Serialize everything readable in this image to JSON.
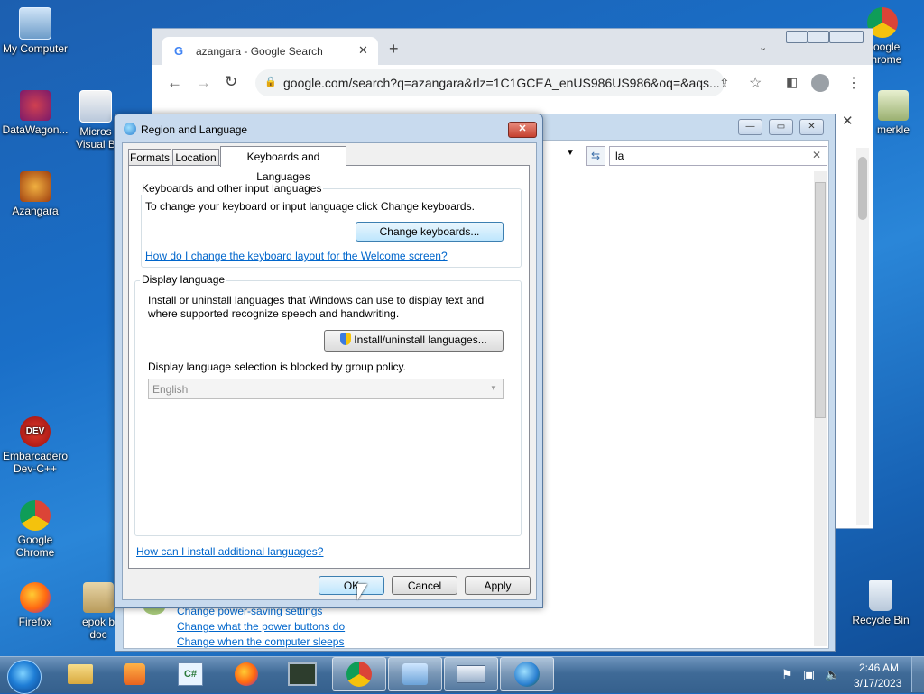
{
  "desktop": {
    "icons": [
      {
        "label": "My Computer"
      },
      {
        "label": "DataWagon..."
      },
      {
        "label": "Micros Visual B"
      },
      {
        "label": "Azangara"
      },
      {
        "label": "Embarcadero Dev-C++"
      },
      {
        "label": "Google Chrome"
      },
      {
        "label": "Firefox"
      },
      {
        "label": "epok b doc"
      },
      {
        "label": "Google Chrome"
      },
      {
        "label": "merkle"
      },
      {
        "label": "Recycle Bin"
      }
    ]
  },
  "chrome": {
    "tab_title": "azangara - Google Search",
    "url": "google.com/search?q=azangara&rlz=1C1GCEA_enUS986US986&oq=&aqs..."
  },
  "back_window": {
    "search_value": "la",
    "links": [
      "Change power-saving settings",
      "Change what the power buttons do",
      "Change when the computer sleeps"
    ]
  },
  "dialog": {
    "title": "Region and Language",
    "tabs": [
      "Formats",
      "Location",
      "Keyboards and Languages"
    ],
    "keyboards_group": {
      "title": "Keyboards and other input languages",
      "desc": "To change your keyboard or input language click Change keyboards.",
      "button": "Change keyboards...",
      "link": "How do I change the keyboard layout for the Welcome screen?"
    },
    "display_group": {
      "title": "Display language",
      "desc_line1": "Install or uninstall languages that Windows can use to display text and",
      "desc_line2": "where supported recognize speech and handwriting.",
      "button": "Install/uninstall languages...",
      "blocked": "Display language selection is blocked by group policy.",
      "selected": "English"
    },
    "bottom_link": "How can I install additional languages?",
    "ok": "OK",
    "cancel": "Cancel",
    "apply": "Apply"
  },
  "tray": {
    "time": "2:46 AM",
    "date": "3/17/2023"
  }
}
